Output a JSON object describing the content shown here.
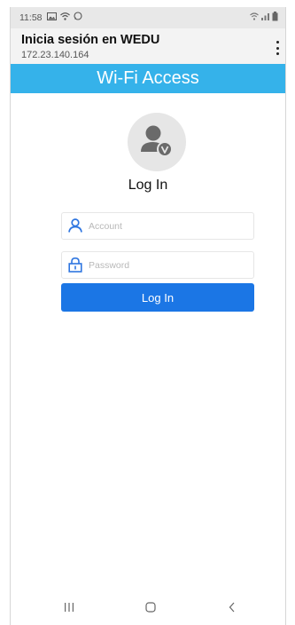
{
  "status_bar": {
    "time": "11:58",
    "left_icons": [
      "image-icon",
      "wifi-icon",
      "whatsapp-icon"
    ],
    "right_icons": [
      "wifi-icon",
      "signal-icon",
      "battery-icon"
    ]
  },
  "browser": {
    "page_title": "Inicia sesión en WEDU",
    "address": "172.23.140.164",
    "menu_icon": "more-vert-icon"
  },
  "portal": {
    "banner_text": "Wi-Fi Access",
    "avatar_icon": "user-avatar-icon",
    "heading": "Log In"
  },
  "form": {
    "account": {
      "placeholder": "Account",
      "value": "",
      "icon": "user-icon"
    },
    "password": {
      "placeholder": "Password",
      "value": "",
      "icon": "lock-icon"
    },
    "submit_label": "Log In"
  },
  "colors": {
    "banner": "#35b2ea",
    "button": "#1b76e5",
    "icon_accent": "#2f76e0"
  },
  "nav_bar": {
    "buttons": [
      "recent-apps-icon",
      "home-icon",
      "back-icon"
    ]
  }
}
